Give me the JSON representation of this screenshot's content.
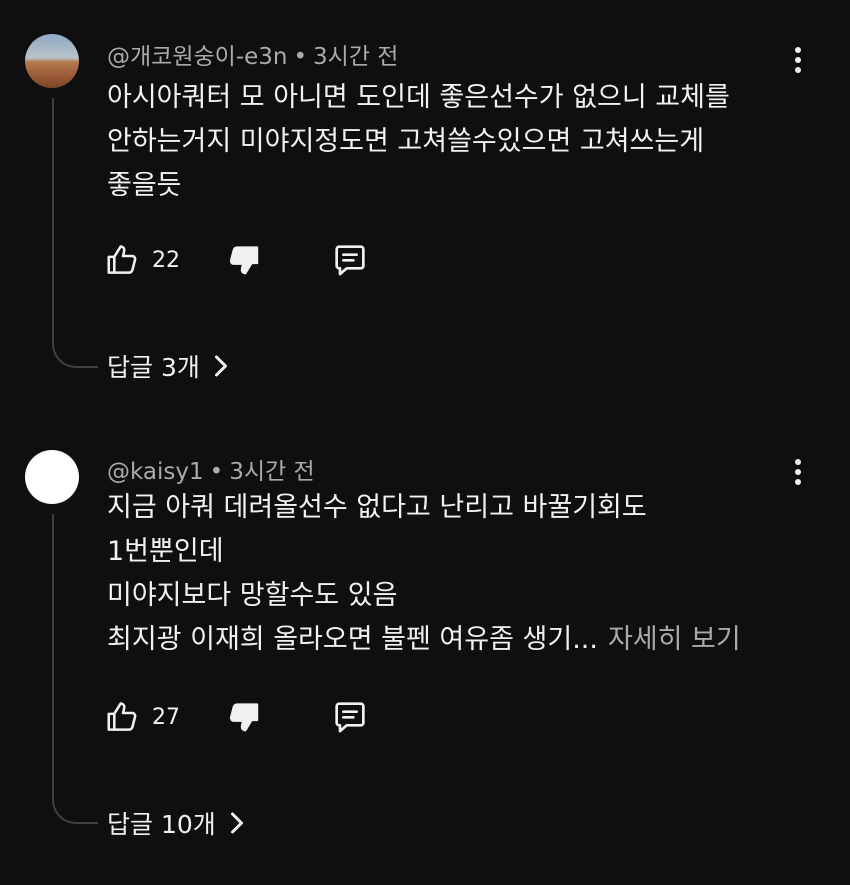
{
  "comments": [
    {
      "author": "@개코원숭이-e3n",
      "time": "3시간 전",
      "lines": [
        "아시아쿼터 모 아니면 도인데 좋은선수가 없으니 교체를",
        "안하는거지 미야지정도면 고쳐쓸수있으면 고쳐쓰는게",
        "좋을듯"
      ],
      "likes": "22",
      "replies_label": "답글 3개"
    },
    {
      "author": "@kaisy1",
      "time": "3시간 전",
      "lines": [
        "지금 아쿼 데려올선수 없다고 난리고 바꿀기회도",
        "1번뿐인데",
        "미야지보다 망할수도 있음",
        "최지광 이재희 올라오면 불펜 여유좀 생기..."
      ],
      "read_more": "자세히 보기",
      "likes": "27",
      "replies_label": "답글 10개"
    }
  ],
  "separator": "•",
  "icons": {
    "like": "thumbs-up-icon",
    "dislike": "thumbs-down-icon",
    "reply": "comment-icon",
    "more": "vertical-dots-icon",
    "chevron": "chevron-right-icon"
  },
  "colors": {
    "background": "#0f0f0f",
    "text": "#f1f1f1",
    "secondary_text": "#aaaaaa",
    "thread_line": "#3f3f3f"
  }
}
